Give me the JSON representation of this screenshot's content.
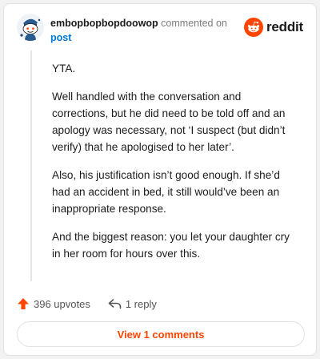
{
  "comment": {
    "username": "embopbopbopdoowop",
    "action_text": "commented on",
    "post_link": "post",
    "paragraphs": [
      "YTA.",
      "Well handled with the conversation and corrections, but he did need to be told off and an apology was necessary, not ‘I suspect (but didn’t verify) that he apologised to her later’.",
      "Also, his justification isn’t good enough. If she’d had an accident in bed, it still would’ve been an inappropriate response.",
      "And the biggest reason: you let your daughter cry in her room for hours over this."
    ]
  },
  "brand": {
    "name": "reddit",
    "color": "#ff4500"
  },
  "actions": {
    "upvotes": "396 upvotes",
    "replies": "1 reply"
  },
  "view_comments_label": "View 1 comments",
  "icons": {
    "avatar": "snoo-avatar-icon",
    "logo": "reddit-logo-icon",
    "upvote": "upvote-arrow-icon",
    "reply": "reply-arrow-icon"
  }
}
